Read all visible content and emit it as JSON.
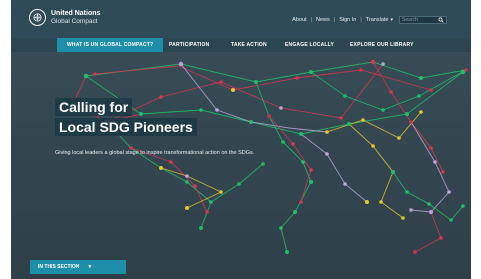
{
  "header": {
    "org_line1": "United Nations",
    "org_line2": "Global Compact"
  },
  "utility_nav": {
    "about": "About",
    "news": "News",
    "sign_in": "Sign In",
    "translate": "Translate",
    "search_placeholder": "Search"
  },
  "main_nav": {
    "items": [
      "WHAT IS UN GLOBAL COMPACT?",
      "PARTICIPATION",
      "TAKE ACTION",
      "ENGAGE LOCALLY",
      "EXPLORE OUR LIBRARY"
    ],
    "active_index": 0
  },
  "hero": {
    "title_line1": "Calling for",
    "title_line2": "Local SDG Pioneers",
    "subtitle": "Giving local leaders a global stage to inspire transformational action on the SDGs."
  },
  "section_button": {
    "label": "IN THIS SECTION"
  },
  "colors": {
    "header_bg": "#2f4b57",
    "accent": "#1f8ea8",
    "network_green": "#1fbf6a",
    "network_red": "#d9344d",
    "network_yellow": "#e3c62d",
    "network_violet": "#b9a6d8"
  }
}
